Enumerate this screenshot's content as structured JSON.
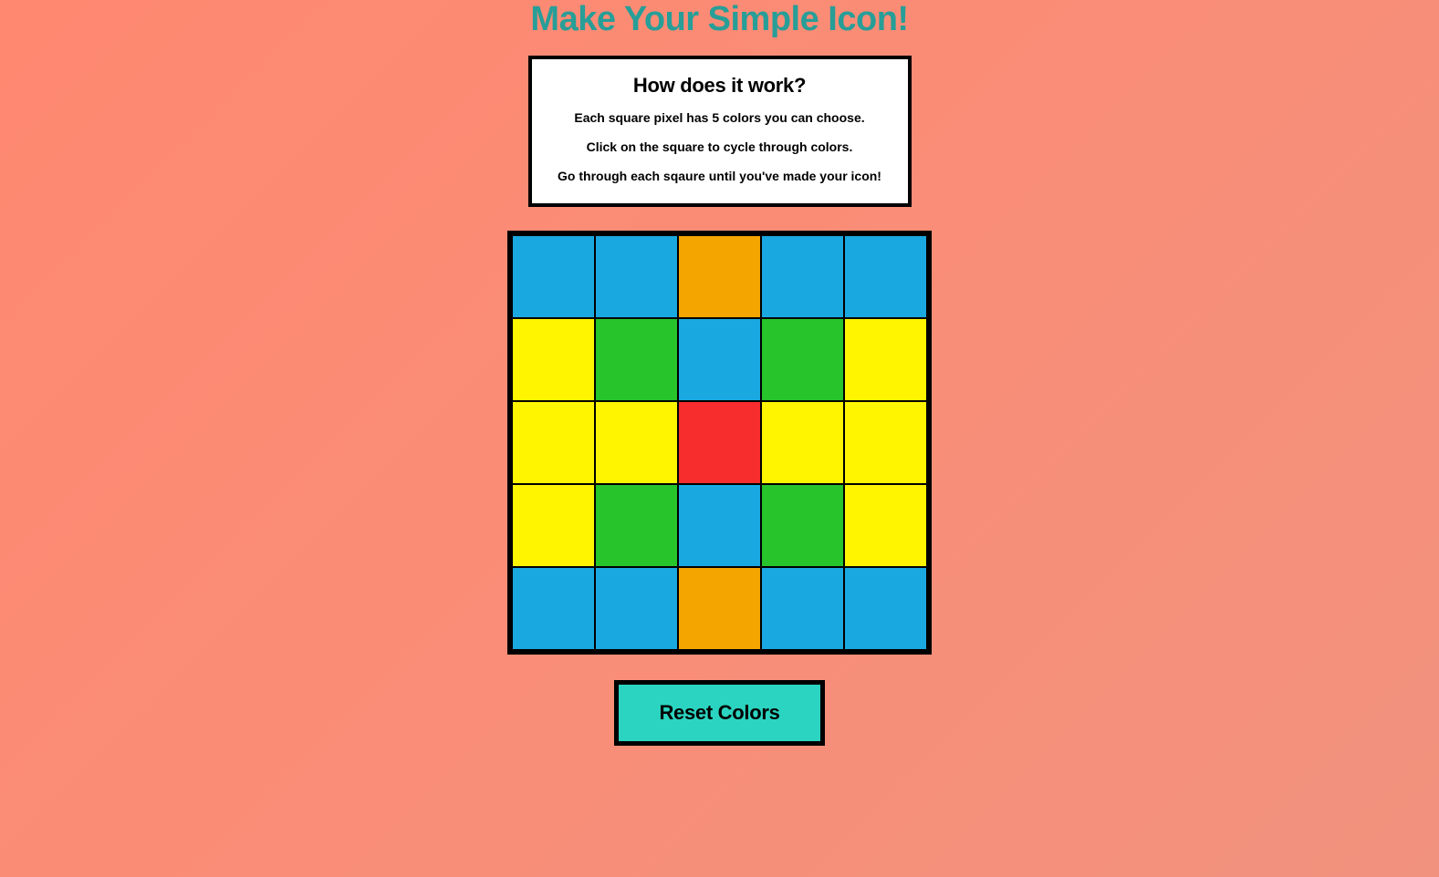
{
  "title": "Make Your Simple Icon!",
  "info": {
    "heading": "How does it work?",
    "line1_pre": "Each square pixel has ",
    "line1_bold": "5 colors",
    "line1_post": " you can choose.",
    "line2": "Click on the square to cycle through colors.",
    "line3": "Go through each sqaure until you've made your icon!"
  },
  "palette": {
    "blue": "#1aa8e0",
    "orange": "#f5a500",
    "yellow": "#fff500",
    "green": "#27c42c",
    "red": "#f72c2c"
  },
  "grid": [
    [
      "blue",
      "blue",
      "orange",
      "blue",
      "blue"
    ],
    [
      "yellow",
      "green",
      "blue",
      "green",
      "yellow"
    ],
    [
      "yellow",
      "yellow",
      "red",
      "yellow",
      "yellow"
    ],
    [
      "yellow",
      "green",
      "blue",
      "green",
      "yellow"
    ],
    [
      "blue",
      "blue",
      "orange",
      "blue",
      "blue"
    ]
  ],
  "reset_label": "Reset Colors"
}
